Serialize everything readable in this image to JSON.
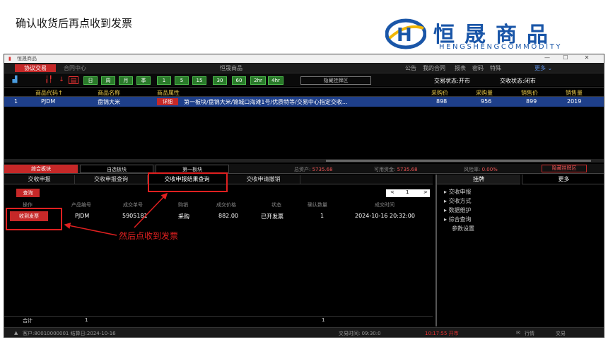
{
  "slide": {
    "title": "确认收货后再点收到发票",
    "logo_cn": "恒晟商品",
    "logo_en": "HENGSHENGCOMMODITY",
    "annotation": "然后点收到发票"
  },
  "window": {
    "title": "恒晟商品",
    "controls": [
      "—",
      "☐",
      "✕"
    ]
  },
  "menubar": {
    "active_tab": "协议交易",
    "inactive_tab": "合同中心",
    "center_title": "恒晟商品",
    "right_items": [
      "公告",
      "我的合同",
      "报表",
      "密码",
      "特殊"
    ],
    "more": "更多 ⌄"
  },
  "toolbar": {
    "periods": [
      "日",
      "周",
      "月",
      "季",
      "1",
      "5",
      "15",
      "30",
      "60",
      "2hr",
      "4hr"
    ],
    "hide_button": "隐藏挂牌区",
    "trade_status": "交易状态:开市",
    "delivery_status": "交收状态:闭市"
  },
  "quote_table": {
    "headers": [
      "商品代码↑",
      "商品名称",
      "商品属性",
      "采购价",
      "采购量",
      "销售价",
      "销售量"
    ],
    "rows": [
      {
        "index": "1",
        "code": "PJDM",
        "name": "盘锦大米",
        "detail": "详细",
        "attr": "第一板块/盘锦大米/锦城口海滩1号/优质特等/交易中心指定交收...",
        "buy_price": "898",
        "buy_qty": "956",
        "sell_price": "899",
        "sell_qty": "2019"
      }
    ]
  },
  "subtabs": {
    "items": [
      "综合板块",
      "自选板块",
      "第一板块"
    ],
    "total_assets_label": "总资产:",
    "total_assets": "5735.68",
    "available_label": "可用资金:",
    "available": "5735.68",
    "risk_label": "风险率:",
    "risk": "0.00%",
    "hide_button": "隐藏挂牌区"
  },
  "delivery_tabs": [
    "交收申报",
    "交收申报查询",
    "交收申报结果查询",
    "交收申请撤销"
  ],
  "query_button": "查询",
  "pager": {
    "page": "1",
    "prev": "<",
    "next": ">"
  },
  "result_table": {
    "headers": [
      "操作",
      "产品编号",
      "成交单号",
      "购销",
      "成交价格",
      "状态",
      "确认数量",
      "成交时间"
    ],
    "row": {
      "action": "收到发票",
      "product": "PJDM",
      "order_no": "5905181",
      "side": "采购",
      "price": "882.00",
      "status": "已开发票",
      "qty": "1",
      "time": "2024-10-16 20:32:00"
    }
  },
  "right_panel": {
    "tabs": [
      "挂牌",
      "更多"
    ],
    "items": [
      "交收申报",
      "交收方式",
      "数据维护",
      "综合查询",
      "参数设置"
    ]
  },
  "totals": {
    "label": "合计",
    "count": "1",
    "qty": "1"
  },
  "statusbar": {
    "customer": "客户:80010000001 结算日:2024-10-16",
    "trade_time": "交易时间: 09:30:0",
    "clock": "10:17:55 开市",
    "quotes": "行情",
    "trade": "交易"
  },
  "colors": {
    "accent_red": "#c62828",
    "highlight_red": "#e02020",
    "selected_row": "#1e3f8a",
    "header_gold": "#e9c94a",
    "period_green": "#2a7a2a",
    "logo_blue": "#1a56a8"
  }
}
